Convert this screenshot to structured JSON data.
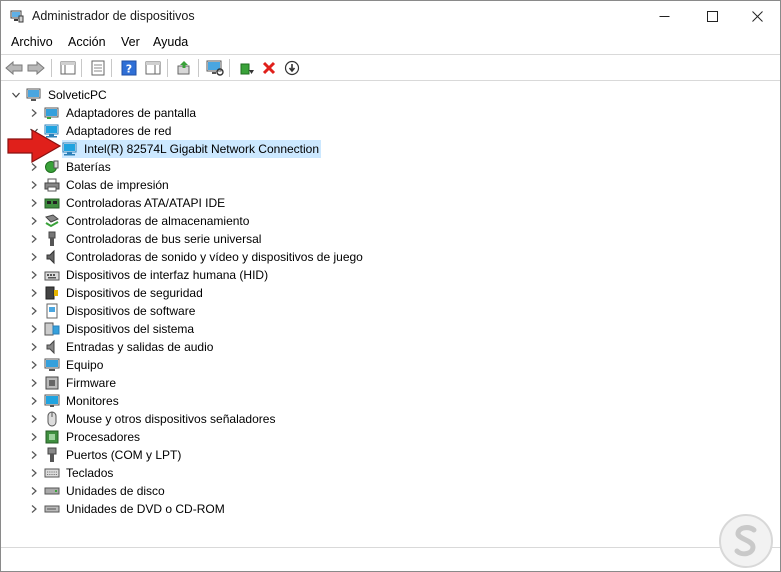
{
  "window": {
    "title": "Administrador de dispositivos"
  },
  "menu": {
    "archivo": "Archivo",
    "accion": "Acción",
    "ver": "Ver",
    "ayuda": "Ayuda"
  },
  "toolbar": {
    "icons": [
      "back-arrow-icon",
      "forward-arrow-icon",
      "show-hide-tree-icon",
      "properties-icon",
      "help-icon",
      "action-pane-icon",
      "update-driver-icon",
      "scan-hardware-icon",
      "enable-device-icon",
      "uninstall-device-icon",
      "disable-device-icon"
    ]
  },
  "tree": {
    "root": "SolveticPC",
    "items": [
      {
        "label": "Adaptadores de pantalla",
        "icon": "display-adapter-icon"
      },
      {
        "label": "Adaptadores de red",
        "icon": "network-adapter-icon",
        "expanded": true
      },
      {
        "label": "Intel(R) 82574L Gigabit Network Connection",
        "icon": "network-adapter-icon",
        "child": true,
        "selected": true
      },
      {
        "label": "Baterías",
        "icon": "battery-icon"
      },
      {
        "label": "Colas de impresión",
        "icon": "printer-icon"
      },
      {
        "label": "Controladoras ATA/ATAPI IDE",
        "icon": "ide-controller-icon"
      },
      {
        "label": "Controladoras de almacenamiento",
        "icon": "storage-controller-icon"
      },
      {
        "label": "Controladoras de bus serie universal",
        "icon": "usb-icon"
      },
      {
        "label": "Controladoras de sonido y vídeo y dispositivos de juego",
        "icon": "sound-icon"
      },
      {
        "label": "Dispositivos de interfaz humana (HID)",
        "icon": "hid-icon"
      },
      {
        "label": "Dispositivos de seguridad",
        "icon": "security-device-icon"
      },
      {
        "label": "Dispositivos de software",
        "icon": "software-device-icon"
      },
      {
        "label": "Dispositivos del sistema",
        "icon": "system-device-icon"
      },
      {
        "label": "Entradas y salidas de audio",
        "icon": "audio-io-icon"
      },
      {
        "label": "Equipo",
        "icon": "computer-icon"
      },
      {
        "label": "Firmware",
        "icon": "firmware-icon"
      },
      {
        "label": "Monitores",
        "icon": "monitor-icon"
      },
      {
        "label": "Mouse y otros dispositivos señaladores",
        "icon": "mouse-icon"
      },
      {
        "label": "Procesadores",
        "icon": "processor-icon"
      },
      {
        "label": "Puertos (COM y LPT)",
        "icon": "port-icon"
      },
      {
        "label": "Teclados",
        "icon": "keyboard-icon"
      },
      {
        "label": "Unidades de disco",
        "icon": "disk-drive-icon"
      },
      {
        "label": "Unidades de DVD o CD-ROM",
        "icon": "dvd-drive-icon"
      }
    ]
  },
  "colors": {
    "selection": "#cce8ff",
    "arrow": "#e0201b",
    "accent_blue": "#1b8fd6"
  }
}
